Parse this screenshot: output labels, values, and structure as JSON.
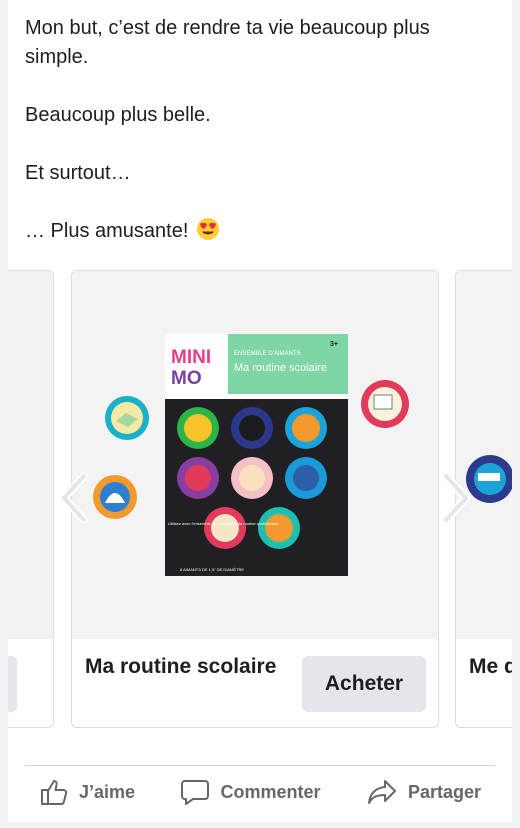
{
  "post": {
    "paragraphs": [
      "Mon but, c’est de rendre ta vie beaucoup plus simple.",
      "Beaucoup plus belle.",
      "Et surtout…",
      "… Plus amusante!"
    ],
    "emoji": "heart-eyes-emoji"
  },
  "carousel": {
    "main_card": {
      "title": "Ma routine scolaire",
      "button_label": "Acheter",
      "product": {
        "brand_top": "MINI",
        "brand_bottom": "MO",
        "header_line": "ENSEMBLE D’AIMANTS",
        "title": "Ma routine scolaire",
        "badge": "3+",
        "bottom_text": "Utilisez avec l’ensemble de motivation Ma routine quotidienne!",
        "footer_text": "8 AIMANTS DE 1.5\" DE DIAMÈTRE"
      }
    },
    "next_card": {
      "title": "Me quo"
    }
  },
  "actions": {
    "like_label": "J’aime",
    "comment_label": "Commenter",
    "share_label": "Partager"
  },
  "colors": {
    "text": "#1c1e21",
    "muted": "#65676b",
    "button_bg": "#e4e6eb",
    "package_green": "#7ed6a6",
    "package_dark": "#1f1f24"
  }
}
